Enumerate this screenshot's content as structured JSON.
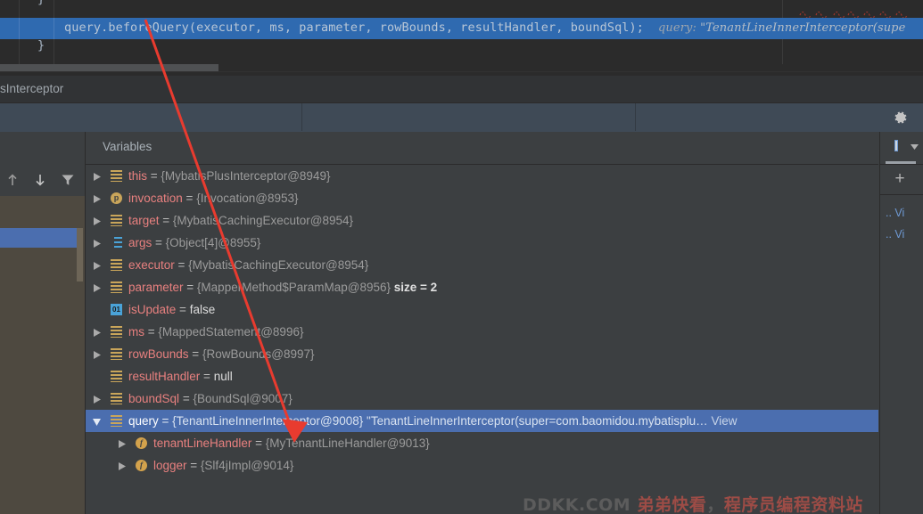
{
  "editor": {
    "partial_line_text": "}",
    "code_line": {
      "text": "query.beforeQuery(executor, ms, parameter, rowBounds, resultHandler, boundSql);",
      "inline_hint_label": "query:",
      "inline_hint_value": "\"TenantLineInnerInterceptor(supe"
    },
    "closing_brace": "}"
  },
  "breadcrumb": {
    "text": "sInterceptor"
  },
  "toolbar": {
    "settings_icon": "gear-icon"
  },
  "frames": {
    "toolbar_icons": [
      "arrow-up-icon",
      "arrow-down-icon",
      "filter-icon"
    ]
  },
  "variables": {
    "title": "Variables",
    "rows": [
      {
        "indent": 0,
        "arrow": "collapsed",
        "icon": "list-icon",
        "icon_glyph": "",
        "name": "this",
        "eq": " = ",
        "value": "{MybatisPlusInterceptor@8949}",
        "extra": "",
        "selected": false
      },
      {
        "indent": 0,
        "arrow": "collapsed",
        "icon": "param-icon",
        "icon_glyph": "p",
        "name": "invocation",
        "eq": " = ",
        "value": "{Invocation@8953}",
        "extra": "",
        "selected": false
      },
      {
        "indent": 0,
        "arrow": "collapsed",
        "icon": "list-icon",
        "icon_glyph": "",
        "name": "target",
        "eq": " = ",
        "value": "{MybatisCachingExecutor@8954}",
        "extra": "",
        "selected": false
      },
      {
        "indent": 0,
        "arrow": "collapsed",
        "icon": "array-icon",
        "icon_glyph": "",
        "name": "args",
        "eq": " = ",
        "value": "{Object[4]@8955}",
        "extra": "",
        "selected": false
      },
      {
        "indent": 0,
        "arrow": "collapsed",
        "icon": "list-icon",
        "icon_glyph": "",
        "name": "executor",
        "eq": " = ",
        "value": "{MybatisCachingExecutor@8954}",
        "extra": "",
        "selected": false
      },
      {
        "indent": 0,
        "arrow": "collapsed",
        "icon": "list-icon",
        "icon_glyph": "",
        "name": "parameter",
        "eq": " = ",
        "value": "{MapperMethod$ParamMap@8956}",
        "extra": "size = 2",
        "selected": false
      },
      {
        "indent": 0,
        "arrow": "none",
        "icon": "boolean-icon",
        "icon_glyph": "01",
        "name": "isUpdate",
        "eq": " = ",
        "value": "false",
        "value_kind": "literal",
        "extra": "",
        "selected": false
      },
      {
        "indent": 0,
        "arrow": "collapsed",
        "icon": "list-icon",
        "icon_glyph": "",
        "name": "ms",
        "eq": " = ",
        "value": "{MappedStatement@8996}",
        "extra": "",
        "selected": false
      },
      {
        "indent": 0,
        "arrow": "collapsed",
        "icon": "list-icon",
        "icon_glyph": "",
        "name": "rowBounds",
        "eq": " = ",
        "value": "{RowBounds@8997}",
        "extra": "",
        "selected": false
      },
      {
        "indent": 0,
        "arrow": "none",
        "icon": "list-icon",
        "icon_glyph": "",
        "name": "resultHandler",
        "eq": " = ",
        "value": "null",
        "value_kind": "literal",
        "extra": "",
        "selected": false
      },
      {
        "indent": 0,
        "arrow": "collapsed",
        "icon": "list-icon",
        "icon_glyph": "",
        "name": "boundSql",
        "eq": " = ",
        "value": "{BoundSql@9007}",
        "extra": "",
        "selected": false
      },
      {
        "indent": 0,
        "arrow": "expanded",
        "icon": "list-icon",
        "icon_glyph": "",
        "name": "query",
        "eq": " = ",
        "value": "{TenantLineInnerInterceptor@9008} \"TenantLineInnerInterceptor(super=com.baomidou.mybatisplu…",
        "extra": "View",
        "selected": true
      },
      {
        "indent": 1,
        "arrow": "collapsed",
        "icon": "field-icon",
        "icon_glyph": "f",
        "name": "tenantLineHandler",
        "eq": " = ",
        "value": "{MyTenantLineHandler@9013}",
        "extra": "",
        "selected": false
      },
      {
        "indent": 1,
        "arrow": "collapsed",
        "icon": "field-icon",
        "icon_glyph": "f",
        "name": "logger",
        "eq": " = ",
        "value": "{Slf4jImpl@9014}",
        "extra": "",
        "selected": false
      }
    ]
  },
  "watches": {
    "add_label": "+",
    "items": [
      ".. Vi",
      ".. Vi"
    ]
  },
  "watermark": {
    "site": "DDKK.COM",
    "cn_part1": "弟弟快看",
    "cn_comma": "，",
    "cn_part2": "程序员编程资料站"
  },
  "colors": {
    "selection_blue": "#4b6eaf",
    "code_selection_blue": "#2f6ab0",
    "editor_bg": "#2b2b2b",
    "panel_bg": "#3c3f41",
    "frames_bg": "#4e4940",
    "toolbar_bg": "#3f4a56",
    "var_name": "#e8807f",
    "var_value": "#9b9b9b",
    "icon_gold": "#c9a55a",
    "icon_blue": "#4aa3d8",
    "annotation_red": "#e83b2f"
  }
}
